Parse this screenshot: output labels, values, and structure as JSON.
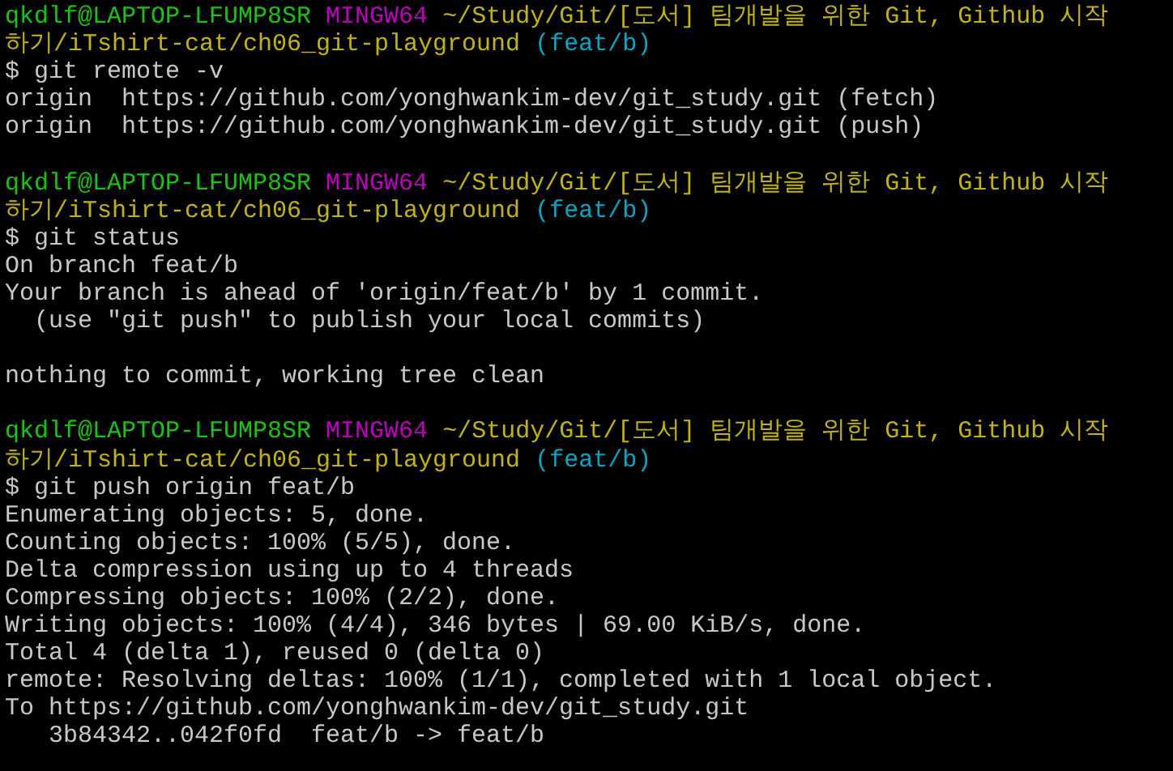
{
  "terminal": {
    "lines": [
      {
        "kind": "text",
        "segments": [
          {
            "kind": "user",
            "text": "qkdlf@LAPTOP-LFUMP8SR"
          },
          {
            "kind": "shell",
            "text": "MINGW64"
          },
          {
            "kind": "path",
            "text": "~/Study/Git/[도서] 팀개발을 위한 Git, Github 시작"
          }
        ]
      },
      {
        "kind": "text",
        "segments": [
          {
            "kind": "path",
            "text": "하기/iTshirt-cat/ch06_git-playground"
          },
          {
            "kind": "branch",
            "text": "(feat/b)"
          }
        ]
      },
      {
        "kind": "text",
        "segments": [
          {
            "kind": "command",
            "text": "$ git remote -v"
          }
        ]
      },
      {
        "kind": "text",
        "segments": [
          {
            "kind": "output",
            "text": "origin  https://github.com/yonghwankim-dev/git_study.git (fetch)"
          }
        ]
      },
      {
        "kind": "text",
        "segments": [
          {
            "kind": "output",
            "text": "origin  https://github.com/yonghwankim-dev/git_study.git (push)"
          }
        ]
      },
      {
        "kind": "blank"
      },
      {
        "kind": "text",
        "segments": [
          {
            "kind": "user",
            "text": "qkdlf@LAPTOP-LFUMP8SR"
          },
          {
            "kind": "shell",
            "text": "MINGW64"
          },
          {
            "kind": "path",
            "text": "~/Study/Git/[도서] 팀개발을 위한 Git, Github 시작"
          }
        ]
      },
      {
        "kind": "text",
        "segments": [
          {
            "kind": "path",
            "text": "하기/iTshirt-cat/ch06_git-playground"
          },
          {
            "kind": "branch",
            "text": "(feat/b)"
          }
        ]
      },
      {
        "kind": "text",
        "segments": [
          {
            "kind": "command",
            "text": "$ git status"
          }
        ]
      },
      {
        "kind": "text",
        "segments": [
          {
            "kind": "output",
            "text": "On branch feat/b"
          }
        ]
      },
      {
        "kind": "text",
        "segments": [
          {
            "kind": "output",
            "text": "Your branch is ahead of 'origin/feat/b' by 1 commit."
          }
        ]
      },
      {
        "kind": "text",
        "segments": [
          {
            "kind": "output",
            "text": "  (use \"git push\" to publish your local commits)"
          }
        ]
      },
      {
        "kind": "blank"
      },
      {
        "kind": "text",
        "segments": [
          {
            "kind": "output",
            "text": "nothing to commit, working tree clean"
          }
        ]
      },
      {
        "kind": "blank"
      },
      {
        "kind": "text",
        "segments": [
          {
            "kind": "user",
            "text": "qkdlf@LAPTOP-LFUMP8SR"
          },
          {
            "kind": "shell",
            "text": "MINGW64"
          },
          {
            "kind": "path",
            "text": "~/Study/Git/[도서] 팀개발을 위한 Git, Github 시작"
          }
        ]
      },
      {
        "kind": "text",
        "segments": [
          {
            "kind": "path",
            "text": "하기/iTshirt-cat/ch06_git-playground"
          },
          {
            "kind": "branch",
            "text": "(feat/b)"
          }
        ]
      },
      {
        "kind": "text",
        "segments": [
          {
            "kind": "command",
            "text": "$ git push origin feat/b"
          }
        ]
      },
      {
        "kind": "text",
        "segments": [
          {
            "kind": "output",
            "text": "Enumerating objects: 5, done."
          }
        ]
      },
      {
        "kind": "text",
        "segments": [
          {
            "kind": "output",
            "text": "Counting objects: 100% (5/5), done."
          }
        ]
      },
      {
        "kind": "text",
        "segments": [
          {
            "kind": "output",
            "text": "Delta compression using up to 4 threads"
          }
        ]
      },
      {
        "kind": "text",
        "segments": [
          {
            "kind": "output",
            "text": "Compressing objects: 100% (2/2), done."
          }
        ]
      },
      {
        "kind": "text",
        "segments": [
          {
            "kind": "output",
            "text": "Writing objects: 100% (4/4), 346 bytes | 69.00 KiB/s, done."
          }
        ]
      },
      {
        "kind": "text",
        "segments": [
          {
            "kind": "output",
            "text": "Total 4 (delta 1), reused 0 (delta 0)"
          }
        ]
      },
      {
        "kind": "text",
        "segments": [
          {
            "kind": "output",
            "text": "remote: Resolving deltas: 100% (1/1), completed with 1 local object."
          }
        ]
      },
      {
        "kind": "text",
        "segments": [
          {
            "kind": "output",
            "text": "To https://github.com/yonghwankim-dev/git_study.git"
          }
        ]
      },
      {
        "kind": "text",
        "segments": [
          {
            "kind": "output",
            "text": "   3b84342..042f0fd  feat/b -> feat/b"
          }
        ]
      }
    ]
  }
}
